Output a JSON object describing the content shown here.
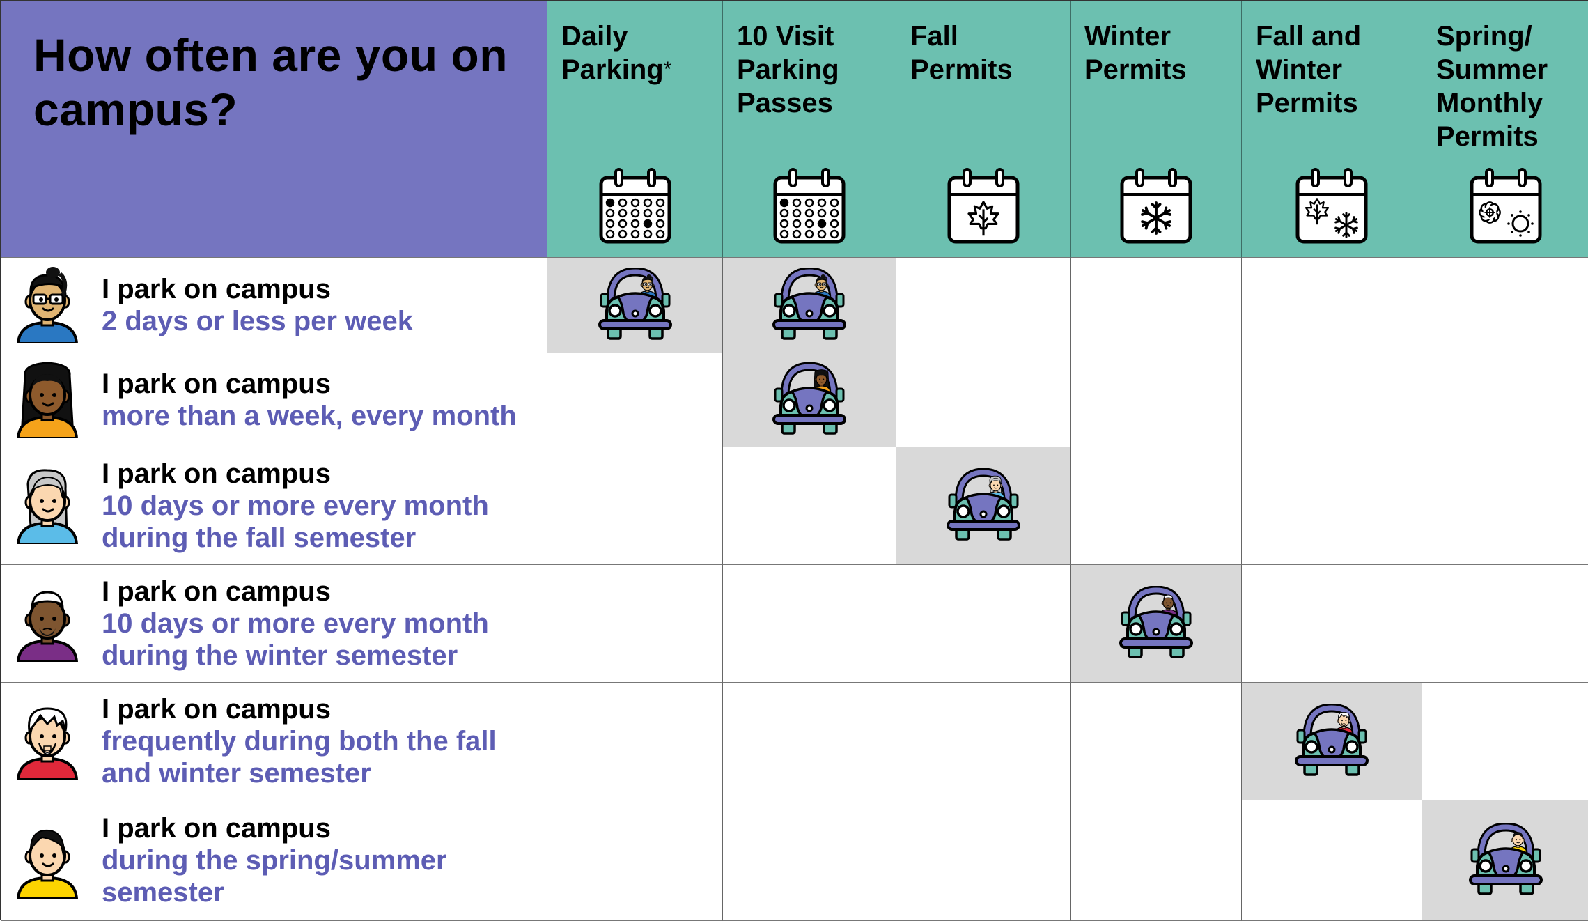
{
  "colors": {
    "question_header_bg": "#7575c0",
    "plan_header_bg": "#6cc0b0",
    "highlight_cell_bg": "#d9d9d9",
    "accent_text": "#5d5db4",
    "car_body": "#7575c0",
    "car_trim": "#6cc0b0"
  },
  "question": "How often are you on campus?",
  "plans": [
    {
      "label": "Daily\nParking",
      "footnote_marker": "*",
      "icon": "calendar-days-icon"
    },
    {
      "label": "10 Visit\nParking\nPasses",
      "footnote_marker": "",
      "icon": "calendar-days-icon"
    },
    {
      "label": "Fall\nPermits",
      "footnote_marker": "",
      "icon": "calendar-maple-leaf-icon"
    },
    {
      "label": "Winter\nPermits",
      "footnote_marker": "",
      "icon": "calendar-snowflake-icon"
    },
    {
      "label": "Fall and\nWinter\nPermits",
      "footnote_marker": "",
      "icon": "calendar-leaf-snowflake-icon"
    },
    {
      "label": "Spring/\nSummer\nMonthly\nPermits",
      "footnote_marker": "",
      "icon": "calendar-flower-sun-icon"
    }
  ],
  "rows": [
    {
      "lead": "I park on campus",
      "detail": "2 days or less per week",
      "avatar": "person-glasses-bun-avatar",
      "recommended": [
        0,
        1
      ]
    },
    {
      "lead": "I park on campus",
      "detail": "more than a week, every month",
      "avatar": "person-curly-hair-avatar",
      "recommended": [
        1
      ]
    },
    {
      "lead": "I park on campus",
      "detail": "10 days or more every month\nduring the fall semester",
      "avatar": "person-long-grey-hair-avatar",
      "recommended": [
        2
      ]
    },
    {
      "lead": "I park on campus",
      "detail": "10 days or more every month\nduring the winter semester",
      "avatar": "person-cap-beard-avatar",
      "recommended": [
        3
      ]
    },
    {
      "lead": "I park on campus",
      "detail": "frequently during both the fall\nand winter semester",
      "avatar": "person-white-hair-goatee-avatar",
      "recommended": [
        4
      ]
    },
    {
      "lead": "I park on campus",
      "detail": "during the spring/summer\nsemester",
      "avatar": "person-short-black-hair-avatar",
      "recommended": [
        5
      ]
    }
  ],
  "recommendation_icon": "car-with-driver-icon"
}
